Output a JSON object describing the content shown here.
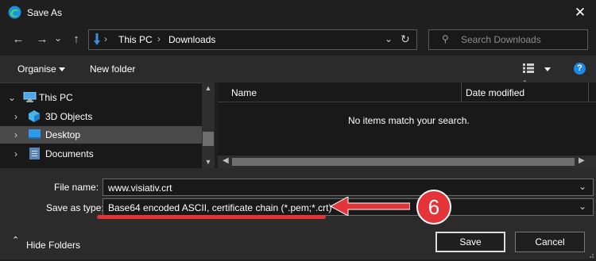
{
  "window": {
    "title": "Save As",
    "close_glyph": "✕"
  },
  "nav": {
    "back_glyph": "←",
    "forward_glyph": "→",
    "chevron_glyph": "⌄",
    "up_glyph": "↑",
    "breadcrumb": [
      "This PC",
      "Downloads"
    ],
    "breadcrumb_sep": "›",
    "refresh_glyph": "↻",
    "search_placeholder": "Search Downloads",
    "search_glyph": "⚲"
  },
  "toolbar": {
    "organise_label": "Organise",
    "new_folder_label": "New folder",
    "help_glyph": "?"
  },
  "sidebar": {
    "items": [
      {
        "label": "This PC",
        "icon": "computer-icon",
        "expand": "⌄"
      },
      {
        "label": "3D Objects",
        "icon": "3d-objects-icon",
        "expand": "›"
      },
      {
        "label": "Desktop",
        "icon": "desktop-icon",
        "expand": "›",
        "selected": true
      },
      {
        "label": "Documents",
        "icon": "documents-icon",
        "expand": "›"
      }
    ]
  },
  "filelist": {
    "columns": [
      "Name",
      "Date modified"
    ],
    "empty_message": "No items match your search."
  },
  "form": {
    "filename_label": "File name:",
    "filename_value": "www.visiativ.crt",
    "savetype_label": "Save as type:",
    "savetype_value": "Base64 encoded ASCII, certificate chain (*.pem;*.crt)",
    "dropdown_glyph": "⌄"
  },
  "footer": {
    "hide_folders_label": "Hide Folders",
    "hide_glyph": "⌃",
    "save_label": "Save",
    "cancel_label": "Cancel"
  },
  "annotation": {
    "step_number": "6"
  },
  "colors": {
    "annotation_red": "#e3343a",
    "accent_blue": "#1e88e5"
  }
}
